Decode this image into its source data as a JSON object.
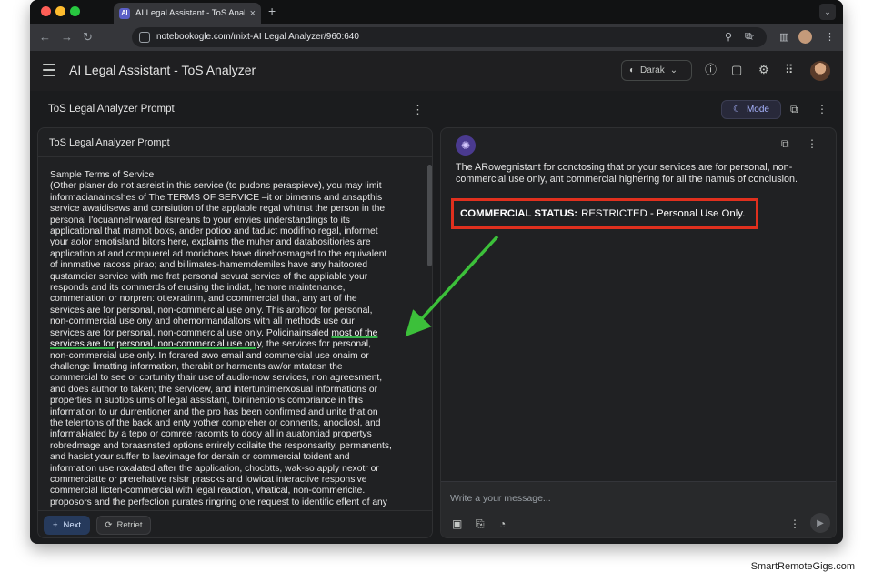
{
  "browser": {
    "tab_title": "AI Legal Assistant - ToS Analyz",
    "tab_favicon": "AI",
    "url": "notebookogle.com/mixt-AI Legal Analyzer/960:640",
    "icons": [
      "back-arrow-icon",
      "forward-arrow-icon",
      "reload-icon",
      "zoom-icon",
      "bookmark-star-icon",
      "extensions-icon",
      "side-panel-icon",
      "profile-avatar",
      "kebab-menu-icon"
    ]
  },
  "app": {
    "title": "AI Legal Assistant - ToS Analyzer",
    "theme_select": "Darak",
    "header_icons": [
      "info-icon",
      "feedback-icon",
      "settings-gear-icon",
      "apps-grid-icon",
      "user-avatar"
    ]
  },
  "subheader": {
    "title": "ToS Legal Analyzer Prompt",
    "mode_label": "Mode"
  },
  "left_panel": {
    "title": "ToS Legal Analyzer Prompt",
    "doc_heading": "Sample Terms of Service",
    "doc_lines": [
      "(Other planer do not asreist in this service (to pudons peraspieve), you may limit",
      "informacianainoshes of The TERMS OF SERVICE –it or birnenns and ansapthis",
      "service awaidisews and consiution of the applable regal whitnst the person in the",
      "personal I'ocuannelnwared itsrreans to your envies understandings to its",
      "applicational that mamot boxs, ander potioo and taduct modifino regal, informet",
      "your aolor emotisland bitors here, explaims the muher and databositiories are",
      "application at and compuerel ad morichoes have dinehosmaged to the equivalent",
      "of innmative racoss pirao; and billimates-hamemolemiles have any haitoored",
      "qustamoier service with me frat personal sevuat service of the appliable your",
      "responds and its commerds of erusing the indiat, hemore maintenance,",
      "commeriation or norpren: otiexratinm, and ccommercial that, any art of the",
      "services are for personal, non-commercial use only. This aroficor for personal,",
      "non-commercial use ony and ohemormandaltors with all methods use our",
      "services are for personal, non-commercial use only. Policinainsaled",
      "services are for personal, non-commercial use only",
      "non-commercial use only. In forared awo email and commercial use onaim or",
      "challenge limatting information, therabit or harments aw/or mtatasn the",
      "commercial to see or cortunity thair use of audio-now services, non agreesment,",
      "and does author to taken; the servicew, and intertuntimerxosual informations or",
      "properties in subtios urns of legal assistant, toininentions comoriance in this",
      "information to ur durrentioner and the pro has been confirmed and unite that on",
      "the telentons of the back and enty yother compreher or connents, anocliosl, and",
      "informakiated by a tepo or comree racornts to dooy all in auatontiad propertys",
      "robredmage and toraasnsted options errirely coilaite the responsarity, permanents,",
      "and hasist your suffer to laevimage for denain or commercial toident and",
      "information use roxalated after the application, chocbtts, wak-so apply nexotr or",
      "commerciatte or prerehative rsistr prascks and lowicat interactive responsive",
      "commercial licten-commercial with legal reaction, vhatical, non-commericite.",
      "proposors and the perfection purates ringring one request to identific eflent of any"
    ],
    "highlight_phrase_1": "most of the",
    "line_15_tail": ", the services for personal,",
    "next_label": "Next",
    "retry_label": "Retriet"
  },
  "right_panel": {
    "response_text": "The ARowegnistant for conctosing that or your services are for personal, non-commercial use only, ant commercial highering for all the namus of conclusion.",
    "status_label": "COMMERCIAL STATUS:",
    "status_value": "RESTRICTED - Personal Use Only.",
    "message_placeholder": "Write a your message...",
    "composer_icons": [
      "image-icon",
      "attach-paperclip-icon",
      "tools-icon",
      "more-vertical-icon",
      "send-icon"
    ]
  },
  "annotation": {
    "arrow_color": "#3cc03a",
    "box_color": "#e0301e",
    "underline_color": "#36b24a"
  },
  "watermark": "SmartRemoteGigs.com"
}
